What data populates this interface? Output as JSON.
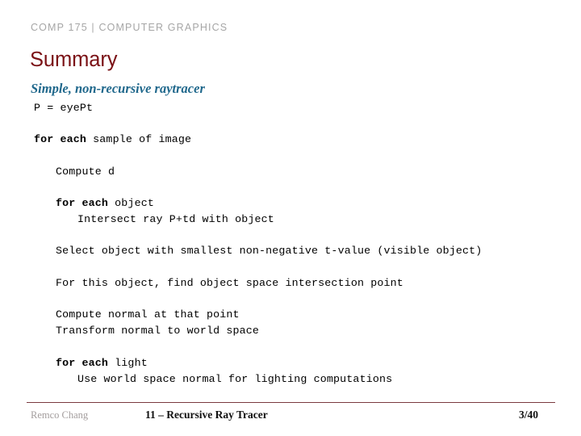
{
  "header": {
    "eyebrow": "COMP 175 | COMPUTER GRAPHICS"
  },
  "title": "Summary",
  "subtitle": "Simple, non-recursive raytracer",
  "code": {
    "l1": "P = eyePt",
    "l2_bold": "for each",
    "l2_rest": " sample of image",
    "l3": "Compute d",
    "l4_bold": "for each",
    "l4_rest": " object",
    "l5": "Intersect ray P+td with object",
    "l6": "Select object with smallest non-negative t-value (visible object)",
    "l7": "For this object, find object space intersection point",
    "l8": "Compute normal at that point",
    "l9": "Transform normal to world space",
    "l10_bold": "for each",
    "l10_rest": " light",
    "l11": "Use world space normal for lighting computations"
  },
  "footer": {
    "author": "Remco Chang",
    "lecture": "11 – Recursive Ray Tracer",
    "page": "3/40"
  },
  "colors": {
    "title": "#7b1216",
    "subtitle": "#20688c",
    "eyebrow": "#a6a6a6",
    "rule": "#7b3a3f",
    "author": "#a39d9d",
    "body": "#000000",
    "background": "#ffffff"
  }
}
